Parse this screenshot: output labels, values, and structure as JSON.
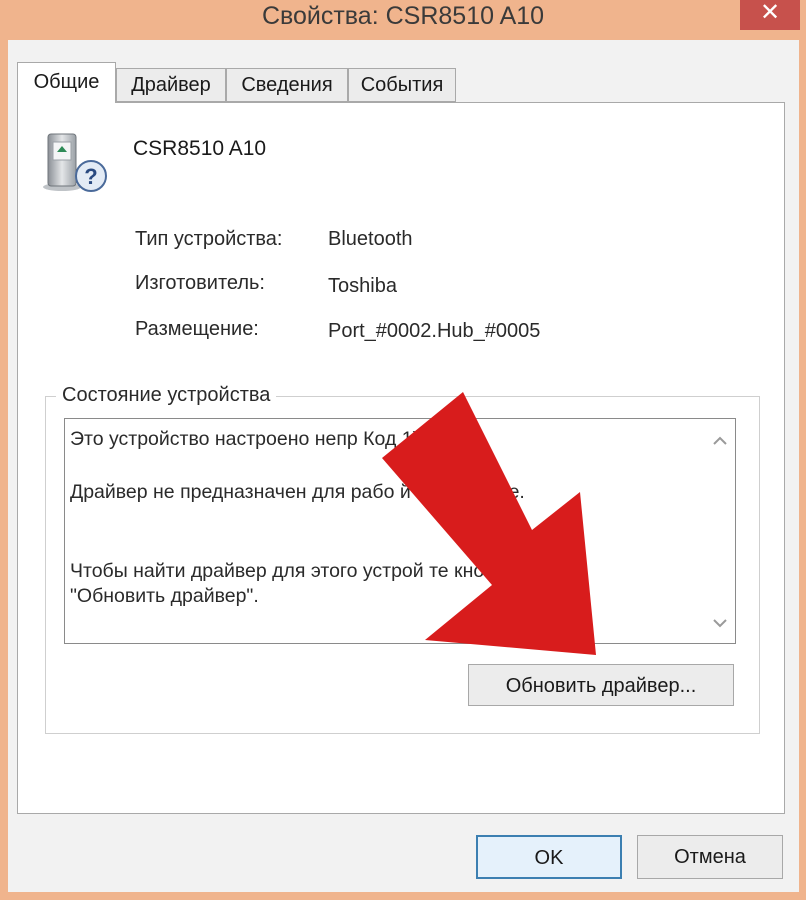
{
  "window": {
    "title": "Свойства: CSR8510 A10",
    "close_glyph": "✕"
  },
  "tabs": [
    {
      "label": "Общие",
      "active": true
    },
    {
      "label": "Драйвер",
      "active": false
    },
    {
      "label": "Сведения",
      "active": false
    },
    {
      "label": "События",
      "active": false
    }
  ],
  "device": {
    "name": "CSR8510 A10",
    "icon": "unknown-device-icon",
    "properties": [
      {
        "label": "Тип устройства:",
        "value": "Bluetooth"
      },
      {
        "label": "Изготовитель:",
        "value": "Toshiba"
      },
      {
        "label": "Размещение:",
        "value": "Port_#0002.Hub_#0005"
      }
    ]
  },
  "status": {
    "group_title": "Состояние устройства",
    "lines": [
      "Это устройство настроено непр                Код 1)",
      "Драйвер не предназначен для рабо              й платформе.",
      "Чтобы найти драйвер для этого устрой                  те кнопку",
      "\"Обновить драйвер\"."
    ],
    "update_button": "Обновить драйвер..."
  },
  "footer": {
    "ok_label": "OK",
    "cancel_label": "Отмена"
  },
  "colors": {
    "title_bar": "#f0b48d",
    "close_button": "#c7514c",
    "annotation_arrow": "#d81c1c",
    "ok_border": "#3c7fb1"
  }
}
